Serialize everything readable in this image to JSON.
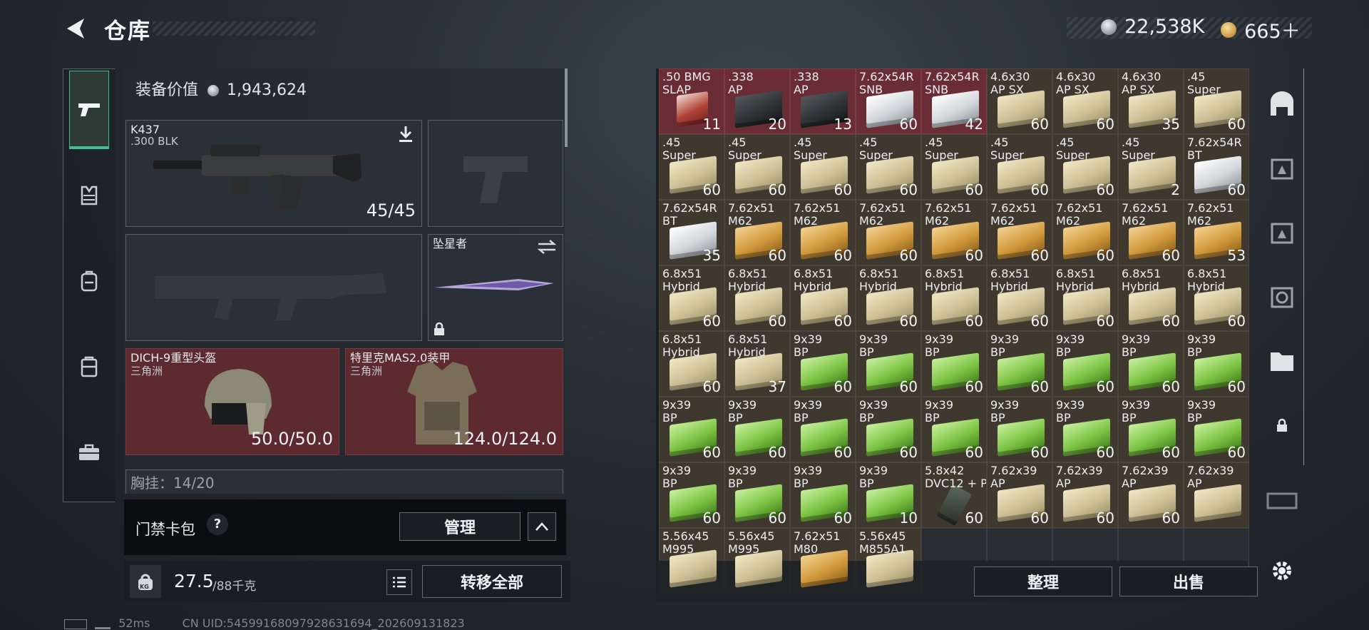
{
  "header": {
    "title": "仓库",
    "currency_silver": "22,538K",
    "currency_gold": "665＋"
  },
  "equipment": {
    "value_label": "装备价值",
    "value": "1,943,624",
    "primary": {
      "name": "K437",
      "caliber": ".300 BLK",
      "ammo": "45/45"
    },
    "melee": {
      "name": "坠星者"
    },
    "helmet": {
      "name": "DICH-9重型头盔",
      "map": "三角洲",
      "durability": "50.0/50.0"
    },
    "armor": {
      "name": "特里克MAS2.0装甲",
      "map": "三角洲",
      "durability": "124.0/124.0"
    },
    "chest_rig": "胸挂：14/20"
  },
  "access_card": {
    "label": "门禁卡包",
    "help": "?",
    "manage_label": "管理"
  },
  "weight": {
    "current": "27.5",
    "max": "/88千克",
    "unit_badge": "KG",
    "transfer_all_label": "转移全部"
  },
  "inventory": {
    "items": [
      {
        "name": ".50 BMG\nSLAP",
        "count": "11",
        "box": "redpk",
        "red": true
      },
      {
        "name": ".338\nAP",
        "count": "20",
        "box": "dark",
        "red": true
      },
      {
        "name": ".338\nAP",
        "count": "13",
        "box": "dark",
        "red": true
      },
      {
        "name": "7.62x54R\nSNB",
        "count": "60",
        "box": "white",
        "red": true
      },
      {
        "name": "7.62x54R\nSNB",
        "count": "42",
        "box": "white",
        "red": true
      },
      {
        "name": "4.6x30\nAP SX",
        "count": "60",
        "box": "tan"
      },
      {
        "name": "4.6x30\nAP SX",
        "count": "60",
        "box": "tan"
      },
      {
        "name": "4.6x30\nAP SX",
        "count": "35",
        "box": "tan"
      },
      {
        "name": ".45\nSuper",
        "count": "60",
        "box": "tan"
      },
      {
        "name": ".45\nSuper",
        "count": "60",
        "box": "tan"
      },
      {
        "name": ".45\nSuper",
        "count": "60",
        "box": "tan"
      },
      {
        "name": ".45\nSuper",
        "count": "60",
        "box": "tan"
      },
      {
        "name": ".45\nSuper",
        "count": "60",
        "box": "tan"
      },
      {
        "name": ".45\nSuper",
        "count": "60",
        "box": "tan"
      },
      {
        "name": ".45\nSuper",
        "count": "60",
        "box": "tan"
      },
      {
        "name": ".45\nSuper",
        "count": "60",
        "box": "tan"
      },
      {
        "name": ".45\nSuper",
        "count": "2",
        "box": "tan"
      },
      {
        "name": "7.62x54R\nBT",
        "count": "60",
        "box": "white"
      },
      {
        "name": "7.62x54R\nBT",
        "count": "35",
        "box": "white"
      },
      {
        "name": "7.62x51\nM62",
        "count": "60",
        "box": "orange"
      },
      {
        "name": "7.62x51\nM62",
        "count": "60",
        "box": "orange"
      },
      {
        "name": "7.62x51\nM62",
        "count": "60",
        "box": "orange"
      },
      {
        "name": "7.62x51\nM62",
        "count": "60",
        "box": "orange"
      },
      {
        "name": "7.62x51\nM62",
        "count": "60",
        "box": "orange"
      },
      {
        "name": "7.62x51\nM62",
        "count": "60",
        "box": "orange"
      },
      {
        "name": "7.62x51\nM62",
        "count": "60",
        "box": "orange"
      },
      {
        "name": "7.62x51\nM62",
        "count": "53",
        "box": "orange"
      },
      {
        "name": "6.8x51\nHybrid",
        "count": "60",
        "box": "tan"
      },
      {
        "name": "6.8x51\nHybrid",
        "count": "60",
        "box": "tan"
      },
      {
        "name": "6.8x51\nHybrid",
        "count": "60",
        "box": "tan"
      },
      {
        "name": "6.8x51\nHybrid",
        "count": "60",
        "box": "tan"
      },
      {
        "name": "6.8x51\nHybrid",
        "count": "60",
        "box": "tan"
      },
      {
        "name": "6.8x51\nHybrid",
        "count": "60",
        "box": "tan"
      },
      {
        "name": "6.8x51\nHybrid",
        "count": "60",
        "box": "tan"
      },
      {
        "name": "6.8x51\nHybrid",
        "count": "60",
        "box": "tan"
      },
      {
        "name": "6.8x51\nHybrid",
        "count": "60",
        "box": "tan"
      },
      {
        "name": "6.8x51\nHybrid",
        "count": "60",
        "box": "tan"
      },
      {
        "name": "6.8x51\nHybrid",
        "count": "37",
        "box": "tan"
      },
      {
        "name": "9x39\nBP",
        "count": "60",
        "box": "green"
      },
      {
        "name": "9x39\nBP",
        "count": "60",
        "box": "green"
      },
      {
        "name": "9x39\nBP",
        "count": "60",
        "box": "green"
      },
      {
        "name": "9x39\nBP",
        "count": "60",
        "box": "green"
      },
      {
        "name": "9x39\nBP",
        "count": "60",
        "box": "green"
      },
      {
        "name": "9x39\nBP",
        "count": "60",
        "box": "green"
      },
      {
        "name": "9x39\nBP",
        "count": "60",
        "box": "green"
      },
      {
        "name": "9x39\nBP",
        "count": "60",
        "box": "green"
      },
      {
        "name": "9x39\nBP",
        "count": "60",
        "box": "green"
      },
      {
        "name": "9x39\nBP",
        "count": "60",
        "box": "green"
      },
      {
        "name": "9x39\nBP",
        "count": "60",
        "box": "green"
      },
      {
        "name": "9x39\nBP",
        "count": "60",
        "box": "green"
      },
      {
        "name": "9x39\nBP",
        "count": "60",
        "box": "green"
      },
      {
        "name": "9x39\nBP",
        "count": "60",
        "box": "green"
      },
      {
        "name": "9x39\nBP",
        "count": "60",
        "box": "green"
      },
      {
        "name": "9x39\nBP",
        "count": "60",
        "box": "green"
      },
      {
        "name": "9x39\nBP",
        "count": "60",
        "box": "green"
      },
      {
        "name": "9x39\nBP",
        "count": "60",
        "box": "green"
      },
      {
        "name": "9x39\nBP",
        "count": "60",
        "box": "green"
      },
      {
        "name": "9x39\nBP",
        "count": "10",
        "box": "green"
      },
      {
        "name": "5.8x42\nDVC12 + P",
        "count": "60",
        "box": "gun"
      },
      {
        "name": "7.62x39\nAP",
        "count": "60",
        "box": "tan"
      },
      {
        "name": "7.62x39\nAP",
        "count": "60",
        "box": "tan"
      },
      {
        "name": "7.62x39\nAP",
        "count": "60",
        "box": "tan"
      },
      {
        "name": "7.62x39\nAP",
        "count": "",
        "box": "tan"
      },
      {
        "name": "5.56x45\nM995",
        "count": "",
        "box": "tan"
      },
      {
        "name": "5.56x45\nM995",
        "count": "",
        "box": "tan"
      },
      {
        "name": "7.62x51\nM80",
        "count": "",
        "box": "orange"
      },
      {
        "name": "5.56x45\nM855A1",
        "count": "",
        "box": "tan"
      }
    ],
    "sort_label": "整理",
    "sell_label": "出售"
  },
  "status_bar": {
    "ping": "52ms",
    "uid": "CN UID:54599168097928631694_202609131823"
  },
  "colors": {
    "accent": "#3bbf8c",
    "red_slot": "#5d2a30"
  }
}
